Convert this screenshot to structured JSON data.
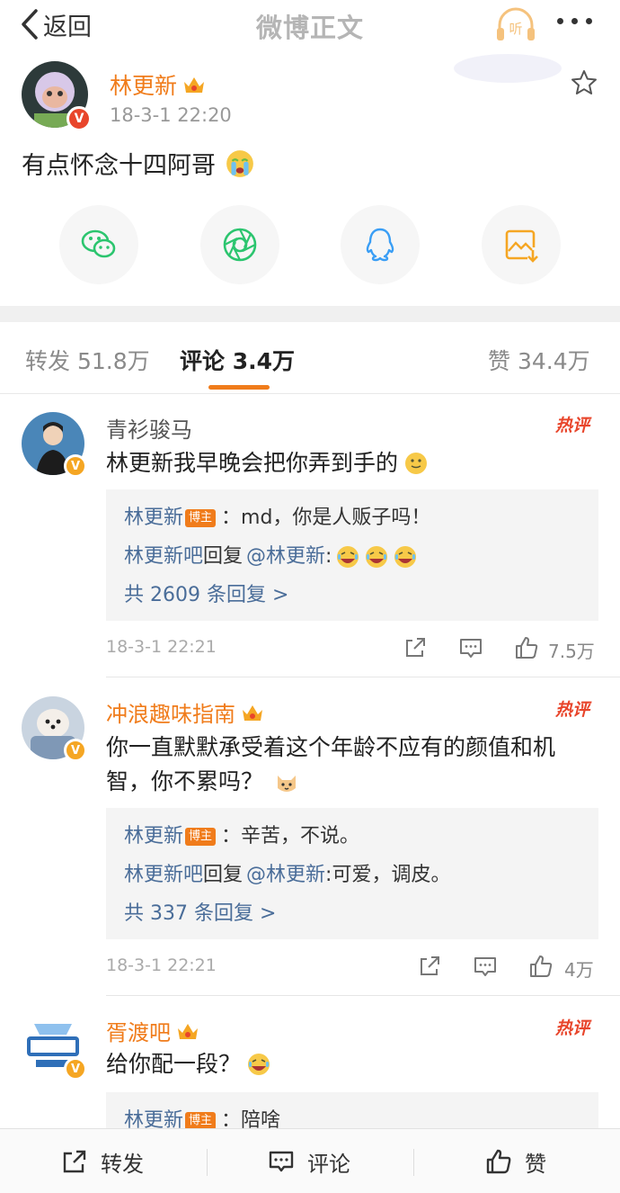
{
  "nav": {
    "back_label": "返回",
    "title": "微博正文",
    "listen_label": "听"
  },
  "post": {
    "author": "林更新",
    "date": "18-3-1 22:20",
    "text": "有点怀念十四阿哥",
    "share_targets": [
      "wechat-icon",
      "moments-icon",
      "qq-icon",
      "save-image-icon"
    ]
  },
  "tabs": {
    "repost": "转发 51.8万",
    "comments": "评论 3.4万",
    "likes": "赞 34.4万"
  },
  "comments": [
    {
      "name": "青衫骏马",
      "hot": "热评",
      "text": "林更新我早晚会把你弄到手的",
      "replies": [
        {
          "user": "林更新",
          "tag": "博主",
          "text": "：md，你是人贩子吗！"
        },
        {
          "user": "林更新吧",
          "mid": "回复",
          "at": "@林更新",
          "text": ":"
        }
      ],
      "more": "共 2609 条回复 >",
      "time": "18-3-1 22:21",
      "likes": "7.5万"
    },
    {
      "name": "冲浪趣味指南",
      "hot": "热评",
      "text": "你一直默默承受着这个年龄不应有的颜值和机智，你不累吗？",
      "replies": [
        {
          "user": "林更新",
          "tag": "博主",
          "text": "：辛苦，不说。"
        },
        {
          "user": "林更新吧",
          "mid": "回复",
          "at": "@林更新",
          "text": ":可爱，调皮。"
        }
      ],
      "more": "共 337 条回复 >",
      "time": "18-3-1 22:21",
      "likes": "4万"
    },
    {
      "name": "胥渡吧",
      "hot": "热评",
      "text": "给你配一段？",
      "replies": [
        {
          "user": "林更新",
          "tag": "博主",
          "text": "：陪啥"
        }
      ]
    }
  ],
  "bottom": {
    "repost": "转发",
    "comment": "评论",
    "like": "赞"
  },
  "colors": {
    "accent": "#f07c1b",
    "link": "#4a6d99",
    "hot": "#e8452b",
    "verified": "#f5a623"
  }
}
